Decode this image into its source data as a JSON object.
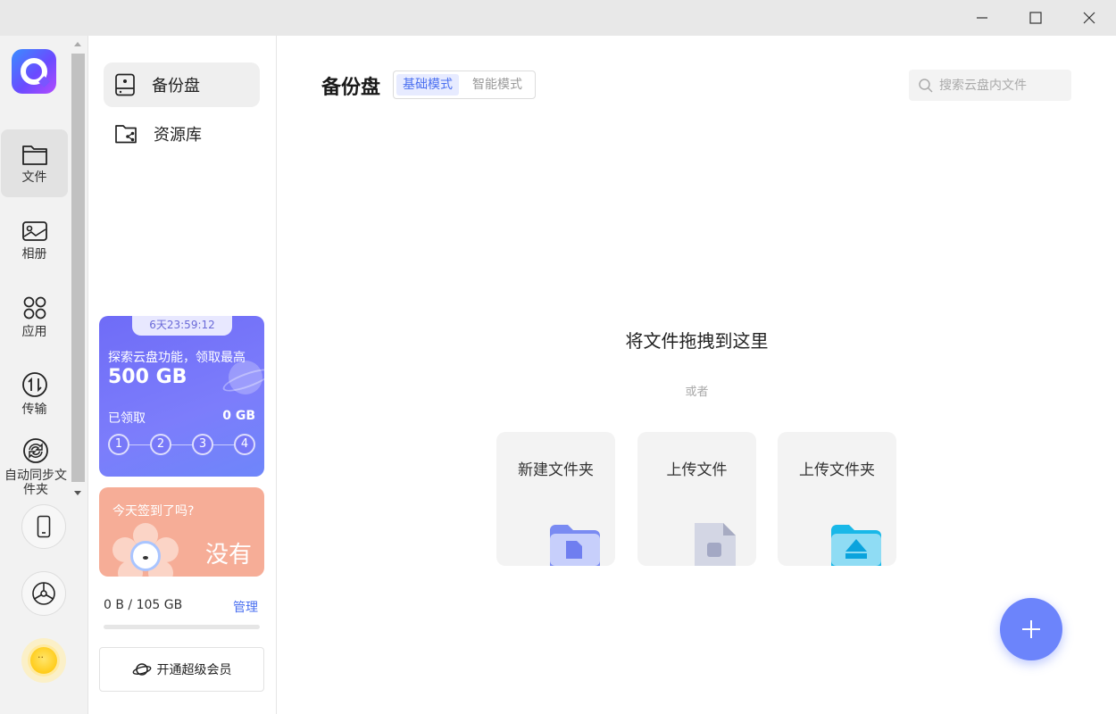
{
  "window": {
    "controls": [
      "minimize",
      "maximize",
      "close"
    ]
  },
  "rail": {
    "items": [
      {
        "label": "文件",
        "icon": "folder-icon",
        "active": true
      },
      {
        "label": "相册",
        "icon": "photo-album-icon",
        "active": false
      },
      {
        "label": "应用",
        "icon": "apps-grid-icon",
        "active": false
      },
      {
        "label": "传输",
        "icon": "transfer-icon",
        "active": false
      },
      {
        "label": "自动同步文件夹",
        "icon": "sync-icon",
        "active": false
      }
    ],
    "bottom_buttons": [
      "phone-icon",
      "settings-icon"
    ],
    "avatar": "sun-avatar"
  },
  "sidebar": {
    "items": [
      {
        "label": "备份盘",
        "icon": "backup-disk-icon",
        "active": true
      },
      {
        "label": "资源库",
        "icon": "shared-folder-icon",
        "active": false
      }
    ],
    "promo": {
      "timer": "6天23:59:12",
      "line1": "探索云盘功能，领取最高",
      "amount": "500 GB",
      "claimed_label": "已领取",
      "claimed_value": "0 GB",
      "steps": [
        "1",
        "2",
        "3",
        "4"
      ],
      "color": "#7378f8"
    },
    "signin": {
      "question": "今天签到了吗?",
      "answer": "没有",
      "color": "#f6ad97"
    },
    "storage": {
      "usage": "0 B / 105 GB",
      "used_fraction": 0,
      "manage_label": "管理"
    },
    "vip_button": "开通超级会员"
  },
  "main": {
    "title": "备份盘",
    "modes": [
      {
        "label": "基础模式",
        "active": true
      },
      {
        "label": "智能模式",
        "active": false
      }
    ],
    "search_placeholder": "搜索云盘内文件",
    "drop_hint": "将文件拖拽到这里",
    "or_hint": "或者",
    "cards": [
      {
        "label": "新建文件夹",
        "icon": "new-folder-icon"
      },
      {
        "label": "上传文件",
        "icon": "upload-file-icon"
      },
      {
        "label": "上传文件夹",
        "icon": "upload-folder-icon"
      }
    ],
    "fab_icon": "plus-icon",
    "accent": "#6c84fb"
  }
}
